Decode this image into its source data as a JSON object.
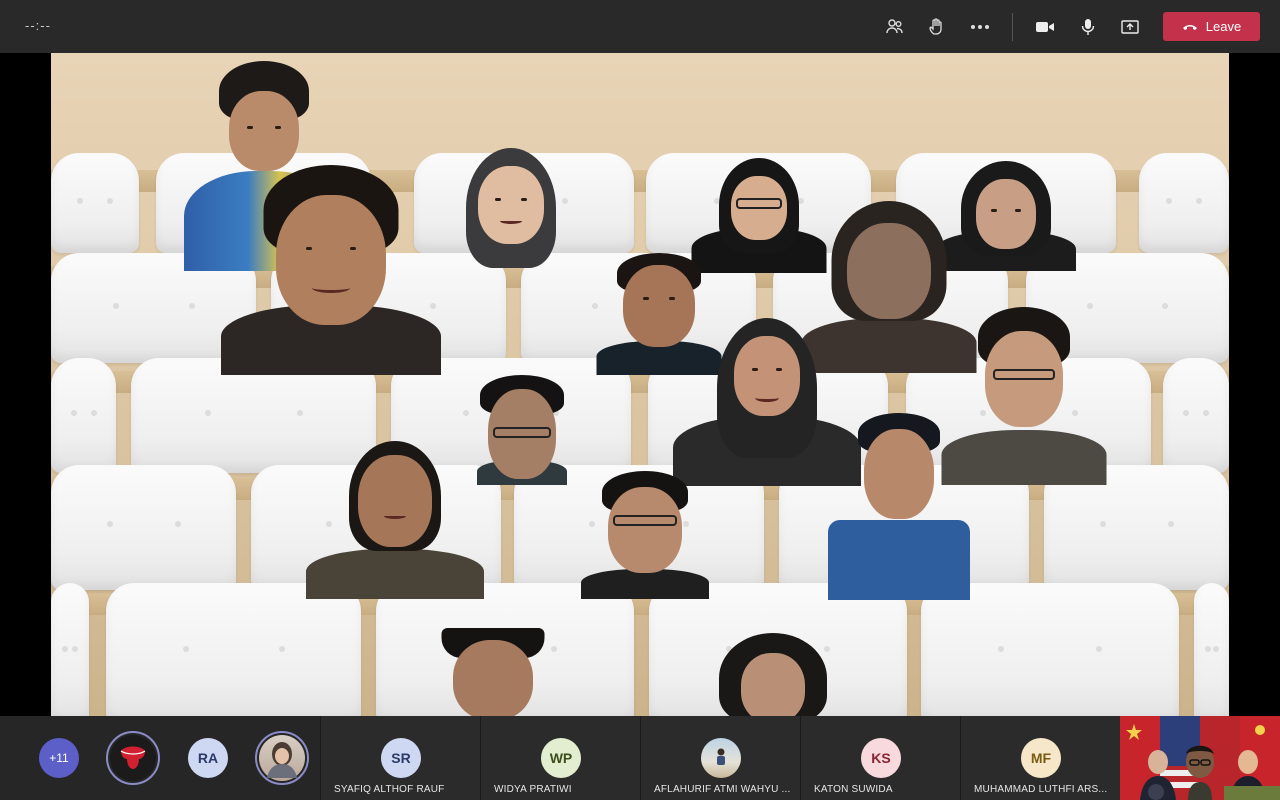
{
  "topbar": {
    "timer": "--:--",
    "icons": [
      "participants-icon",
      "raise-hand-icon",
      "more-options-icon",
      "camera-icon",
      "microphone-icon",
      "share-screen-icon"
    ],
    "leave_label": "Leave",
    "leave_color": "#c4314b"
  },
  "strip": {
    "overflow_count": "+11",
    "bubbles": [
      {
        "initials": "",
        "icon": "tongue-logo-icon"
      },
      {
        "initials": "RA"
      },
      {
        "initials": "",
        "icon": "profile-photo"
      }
    ],
    "tiles": [
      {
        "initials": "SR",
        "name": "SYAFIQ ALTHOF RAUF",
        "color": "#cfd8f3"
      },
      {
        "initials": "WP",
        "name": "WIDYA PRATIWI",
        "color": "#e3edd0"
      },
      {
        "initials": "",
        "name": "AFLAHURIF ATMI WAHYU ...",
        "color": "#d9e3ea"
      },
      {
        "initials": "KS",
        "name": "KATON SUWIDA",
        "color": "#f7d9de"
      },
      {
        "initials": "MF",
        "name": "MUHAMMAD LUTHFI ARS...",
        "color": "#f5e7c8"
      }
    ]
  }
}
